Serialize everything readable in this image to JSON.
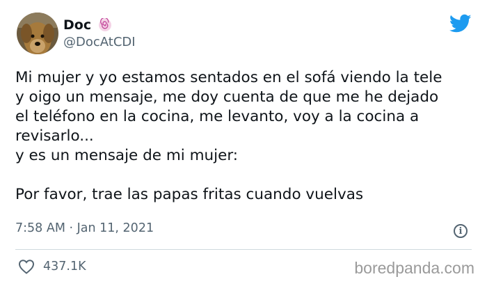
{
  "author": {
    "display_name": "Doc",
    "handle": "@DocAtCDI",
    "avatar_icon": "dog-avatar",
    "badge_icon": "spiral-emoji-icon"
  },
  "tweet": {
    "lines": [
      "Mi mujer y yo estamos sentados en el sofá viendo la tele",
      "y oigo un mensaje, me doy cuenta de que me he dejado",
      "el teléfono en la cocina, me levanto, voy a la cocina a",
      "revisarlo...",
      "y es un mensaje de mi mujer:",
      "",
      "Por favor, trae las papas fritas cuando vuelvas"
    ],
    "timestamp": "7:58 AM · Jan 11, 2021"
  },
  "engagement": {
    "likes": "437.1K"
  },
  "watermark": "boredpanda.com",
  "colors": {
    "twitter_blue": "#1d9bf0",
    "secondary_text": "#536471",
    "primary_text": "#0f1419"
  },
  "icons": {
    "logo": "twitter-bird-icon",
    "info": "info-icon",
    "like": "heart-icon"
  }
}
